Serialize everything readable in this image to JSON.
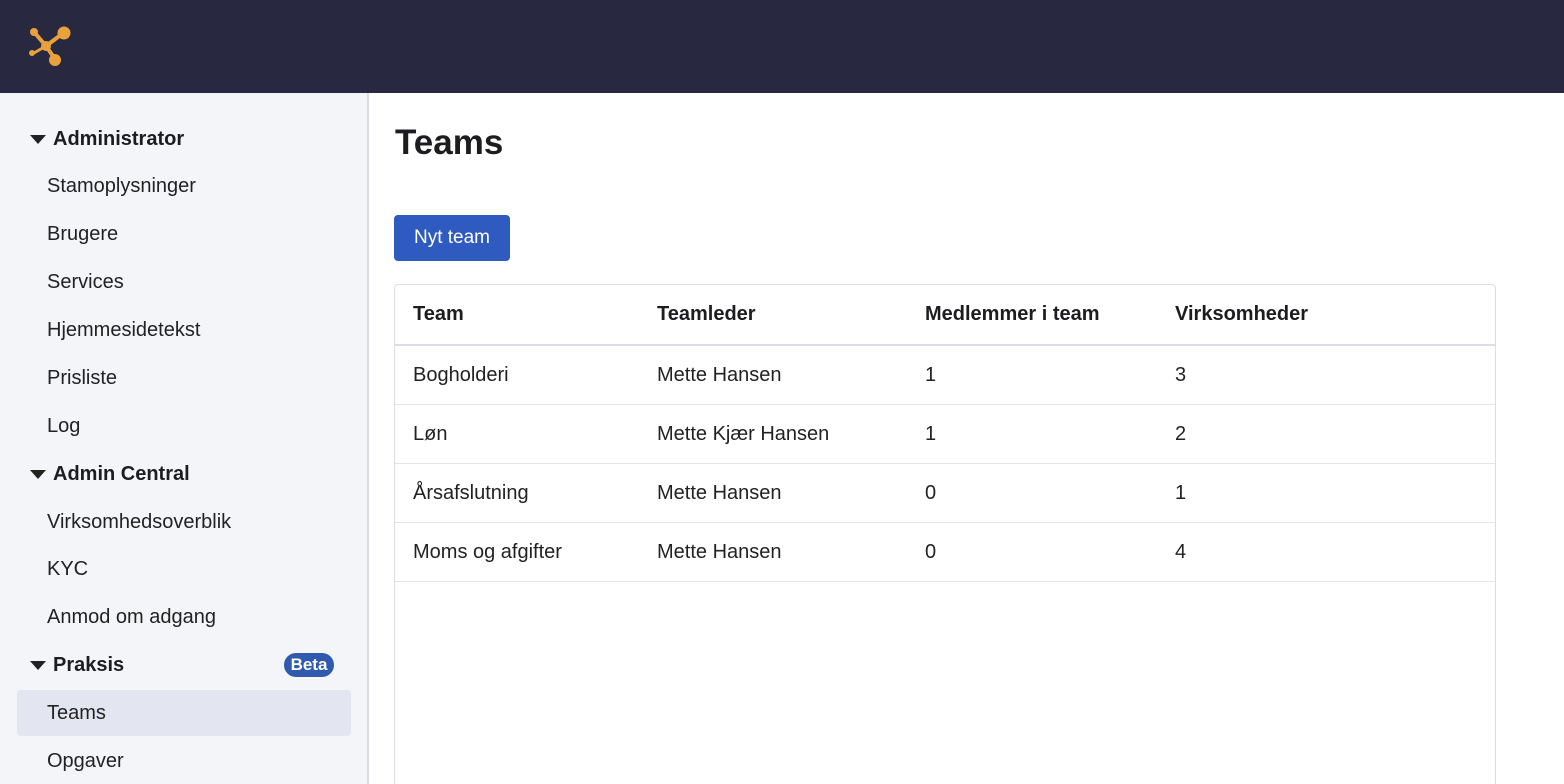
{
  "sidebar": {
    "sections": [
      {
        "title": "Administrator",
        "items": [
          "Stamoplysninger",
          "Brugere",
          "Services",
          "Hjemmesidetekst",
          "Prisliste",
          "Log"
        ]
      },
      {
        "title": "Admin Central",
        "items": [
          "Virksomhedsoverblik",
          "KYC",
          "Anmod om adgang"
        ]
      },
      {
        "title": "Praksis",
        "badge": "Beta",
        "items": [
          "Teams",
          "Opgaver"
        ]
      }
    ],
    "active_item": "Teams"
  },
  "main": {
    "title": "Teams",
    "new_button": "Nyt team",
    "table": {
      "headers": [
        "Team",
        "Teamleder",
        "Medlemmer i team",
        "Virksomheder"
      ],
      "rows": [
        [
          "Bogholderi",
          "Mette Hansen",
          "1",
          "3"
        ],
        [
          "Løn",
          "Mette Kjær Hansen",
          "1",
          "2"
        ],
        [
          "Årsafslutning",
          "Mette Hansen",
          "0",
          "1"
        ],
        [
          "Moms og afgifter",
          "Mette Hansen",
          "0",
          "4"
        ]
      ]
    }
  },
  "colors": {
    "topbar": "#282840",
    "logo": "#e9a23b",
    "primary": "#2f5ac0",
    "badge": "#2f5aad",
    "active_nav": "#e3e6f1"
  },
  "icons": {
    "logo": "network-logo-icon",
    "section_toggle": "caret-down-icon"
  }
}
